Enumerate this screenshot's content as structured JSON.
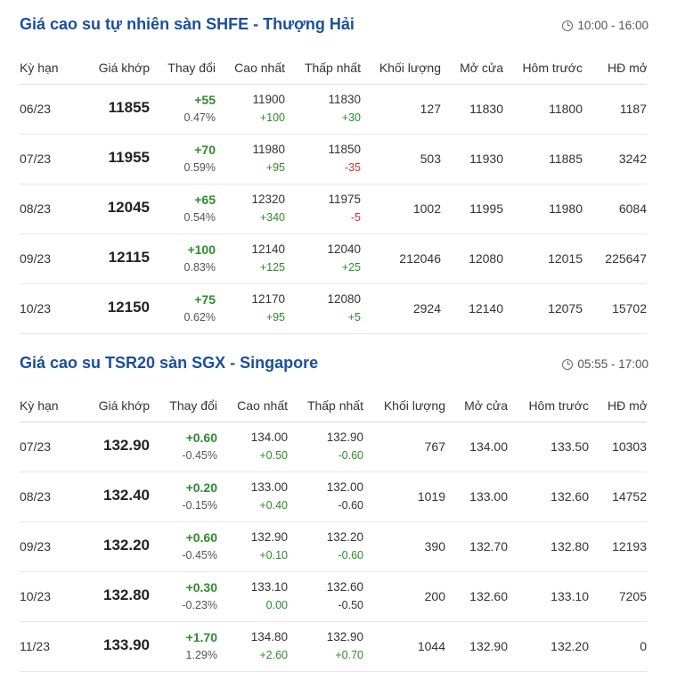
{
  "sections": [
    {
      "title": "Giá cao su tự nhiên sàn SHFE - Thượng Hải",
      "time": "10:00 - 16:00",
      "headers": [
        "Kỳ hạn",
        "Giá khớp",
        "Thay đổi",
        "Cao nhất",
        "Thấp nhất",
        "Khối lượng",
        "Mở cửa",
        "Hôm trước",
        "HĐ mở"
      ],
      "rows": [
        {
          "term": "06/23",
          "price": "11855",
          "change": "+55",
          "pct": "0.47%",
          "high": "11900",
          "high_chg": "+100",
          "high_dir": "up",
          "low": "11830",
          "low_chg": "+30",
          "low_dir": "up",
          "volume": "127",
          "open": "11830",
          "prev": "11800",
          "oi": "1187"
        },
        {
          "term": "07/23",
          "price": "11955",
          "change": "+70",
          "pct": "0.59%",
          "high": "11980",
          "high_chg": "+95",
          "high_dir": "up",
          "low": "11850",
          "low_chg": "-35",
          "low_dir": "down",
          "volume": "503",
          "open": "11930",
          "prev": "11885",
          "oi": "3242"
        },
        {
          "term": "08/23",
          "price": "12045",
          "change": "+65",
          "pct": "0.54%",
          "high": "12320",
          "high_chg": "+340",
          "high_dir": "up",
          "low": "11975",
          "low_chg": "-5",
          "low_dir": "down",
          "volume": "1002",
          "open": "11995",
          "prev": "11980",
          "oi": "6084"
        },
        {
          "term": "09/23",
          "price": "12115",
          "change": "+100",
          "pct": "0.83%",
          "high": "12140",
          "high_chg": "+125",
          "high_dir": "up",
          "low": "12040",
          "low_chg": "+25",
          "low_dir": "up",
          "volume": "212046",
          "open": "12080",
          "prev": "12015",
          "oi": "225647"
        },
        {
          "term": "10/23",
          "price": "12150",
          "change": "+75",
          "pct": "0.62%",
          "high": "12170",
          "high_chg": "+95",
          "high_dir": "up",
          "low": "12080",
          "low_chg": "+5",
          "low_dir": "up",
          "volume": "2924",
          "open": "12140",
          "prev": "12075",
          "oi": "15702"
        }
      ]
    },
    {
      "title": "Giá cao su TSR20 sàn SGX - Singapore",
      "time": "05:55 - 17:00",
      "headers": [
        "Kỳ hạn",
        "Giá khớp",
        "Thay đổi",
        "Cao nhất",
        "Thấp nhất",
        "Khối lượng",
        "Mở cửa",
        "Hôm trước",
        "HĐ mở"
      ],
      "rows": [
        {
          "term": "07/23",
          "price": "132.90",
          "change": "+0.60",
          "pct": "-0.45%",
          "high": "134.00",
          "high_chg": "+0.50",
          "high_dir": "up",
          "low": "132.90",
          "low_chg": "-0.60",
          "low_dir": "up",
          "volume": "767",
          "open": "134.00",
          "prev": "133.50",
          "oi": "10303"
        },
        {
          "term": "08/23",
          "price": "132.40",
          "change": "+0.20",
          "pct": "-0.15%",
          "high": "133.00",
          "high_chg": "+0.40",
          "high_dir": "up",
          "low": "132.00",
          "low_chg": "-0.60",
          "low_dir": "neutral",
          "volume": "1019",
          "open": "133.00",
          "prev": "132.60",
          "oi": "14752"
        },
        {
          "term": "09/23",
          "price": "132.20",
          "change": "+0.60",
          "pct": "-0.45%",
          "high": "132.90",
          "high_chg": "+0.10",
          "high_dir": "up",
          "low": "132.20",
          "low_chg": "-0.60",
          "low_dir": "up",
          "volume": "390",
          "open": "132.70",
          "prev": "132.80",
          "oi": "12193"
        },
        {
          "term": "10/23",
          "price": "132.80",
          "change": "+0.30",
          "pct": "-0.23%",
          "high": "133.10",
          "high_chg": "0.00",
          "high_dir": "up",
          "low": "132.60",
          "low_chg": "-0.50",
          "low_dir": "neutral",
          "volume": "200",
          "open": "132.60",
          "prev": "133.10",
          "oi": "7205"
        },
        {
          "term": "11/23",
          "price": "133.90",
          "change": "+1.70",
          "pct": "1.29%",
          "high": "134.80",
          "high_chg": "+2.60",
          "high_dir": "up",
          "low": "132.90",
          "low_chg": "+0.70",
          "low_dir": "up",
          "volume": "1044",
          "open": "132.90",
          "prev": "132.20",
          "oi": "0"
        }
      ]
    }
  ],
  "colors": {
    "title": "#1a4f9c",
    "up": "#2e8b2e",
    "down": "#d32f2f"
  }
}
